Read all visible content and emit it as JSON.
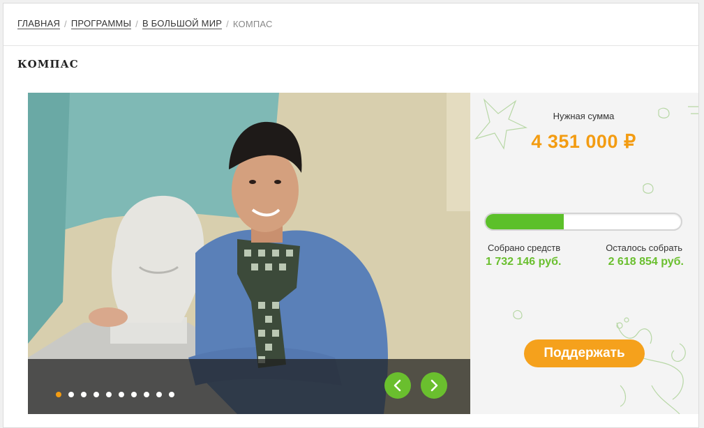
{
  "breadcrumb": {
    "items": [
      "ГЛАВНАЯ",
      "ПРОГРАММЫ",
      "В БОЛЬШОЙ МИР"
    ],
    "current": "КОМПАС",
    "separator": "/"
  },
  "page": {
    "title": "КОМПАС"
  },
  "slider": {
    "slide_count": 10,
    "active_index": 0,
    "prev_icon": "chevron-left-icon",
    "next_icon": "chevron-right-icon"
  },
  "donation": {
    "need_label": "Нужная сумма",
    "need_amount": "4 351 000 ₽",
    "progress_fraction": 0.4,
    "collected_label": "Собрано средств",
    "collected_value": "1 732 146 руб.",
    "remaining_label": "Осталось собрать",
    "remaining_value": "2 618 854 руб.",
    "button_label": "Поддержать"
  },
  "colors": {
    "accent_orange": "#f39c12",
    "accent_green": "#6abf2e",
    "progress_green": "#5cc02a"
  }
}
